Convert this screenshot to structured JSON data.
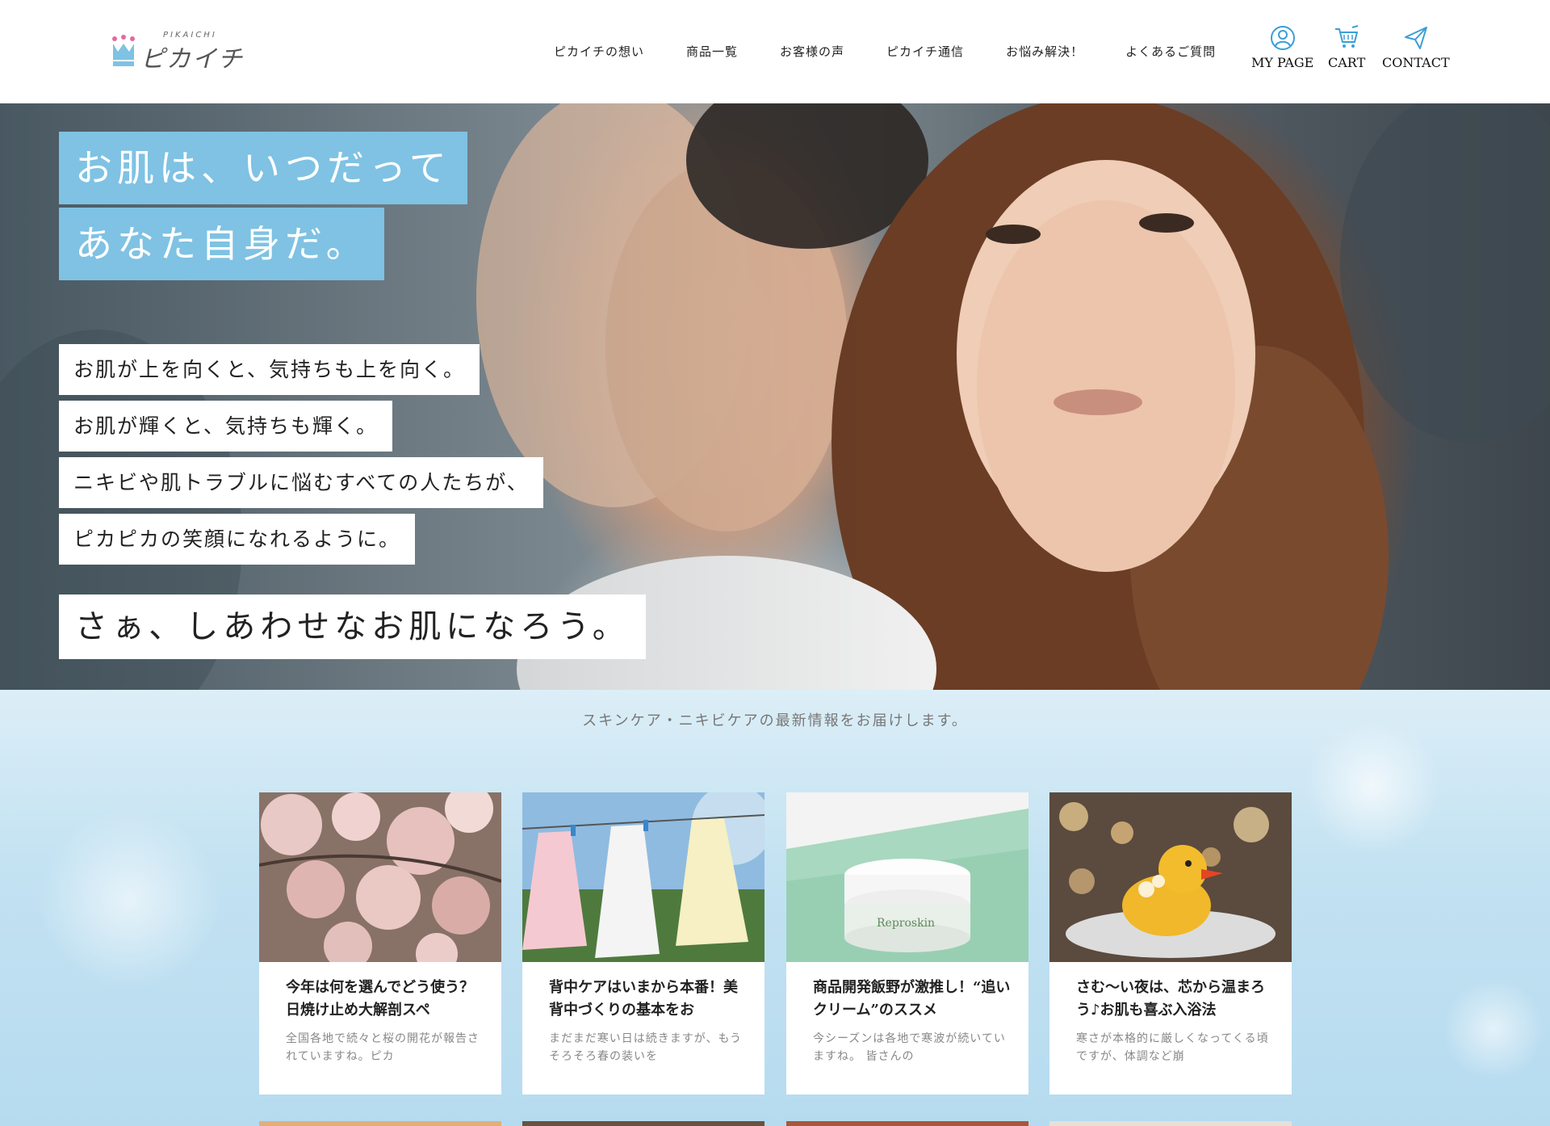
{
  "header": {
    "logo_small": "PIKAICHI",
    "logo_main": "ピカイチ",
    "nav": [
      {
        "label": "ピカイチの想い"
      },
      {
        "label": "商品一覧"
      },
      {
        "label": "お客様の声"
      },
      {
        "label": "ピカイチ通信"
      },
      {
        "label": "お悩み解決！"
      },
      {
        "label": "よくあるご質問"
      }
    ],
    "utility": {
      "mypage": {
        "label": "MY PAGE",
        "icon": "user-icon"
      },
      "cart": {
        "label": "CART",
        "icon": "cart-icon"
      },
      "contact": {
        "label": "CONTACT",
        "icon": "paper-plane-icon"
      }
    }
  },
  "hero": {
    "headline_line1": "お肌は、いつだって",
    "headline_line2": "あなた自身だ。",
    "copy": [
      "お肌が上を向くと、気持ちも上を向く。",
      "お肌が輝くと、気持ちも輝く。",
      "ニキビや肌トラブルに悩むすべての人たちが、",
      "ピカピカの笑顔になれるように。"
    ],
    "cta": "さぁ、しあわせなお肌になろう。"
  },
  "news": {
    "lead": "スキンケア・ニキビケアの最新情報をお届けします。",
    "cards": [
      {
        "title": "今年は何を選んでどう使う？日焼け止め大解剖スペ",
        "excerpt": "全国各地で続々と桜の開花が報告されていますね。ピカ"
      },
      {
        "title": "背中ケアはいまから本番！美背中づくりの基本をお",
        "excerpt": "まだまだ寒い日は続きますが、もうそろそろ春の装いを"
      },
      {
        "title": "商品開発飯野が激推し！“追いクリーム”のススメ",
        "excerpt": "今シーズンは各地で寒波が続いていますね。 皆さんの"
      },
      {
        "title": "さむ～い夜は、芯から温まろう♪お肌も喜ぶ入浴法",
        "excerpt": "寒さが本格的に厳しくなってくる頃ですが、体調など崩"
      }
    ],
    "cream_jar_label": "Reproskin"
  },
  "colors": {
    "accent_blue": "#7fc2e3",
    "icon_blue": "#3a9fd6",
    "logo_pink": "#e46a9a"
  }
}
